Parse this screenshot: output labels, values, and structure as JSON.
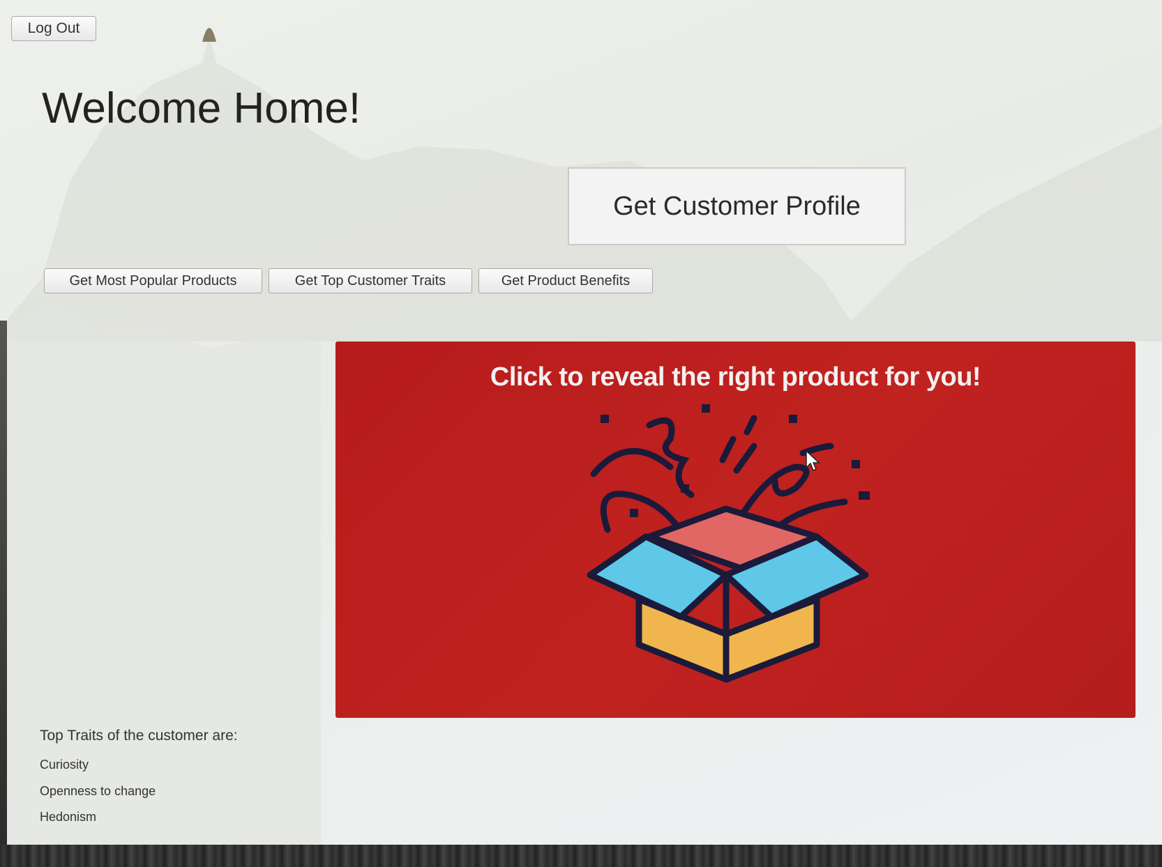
{
  "header": {
    "logout_label": "Log Out",
    "title": "Welcome Home!"
  },
  "actions": {
    "profile_label": "Get Customer Profile",
    "popular_products_label": "Get Most Popular Products",
    "top_traits_label": "Get Top Customer Traits",
    "product_benefits_label": "Get Product Benefits"
  },
  "reveal": {
    "text": "Click to reveal the right product for you!",
    "icon": "gift-box-icon",
    "background_color": "#b91f1f"
  },
  "traits": {
    "title": "Top Traits of the customer are:",
    "items": [
      "Curiosity",
      "Openness to change",
      "Hedonism"
    ]
  }
}
